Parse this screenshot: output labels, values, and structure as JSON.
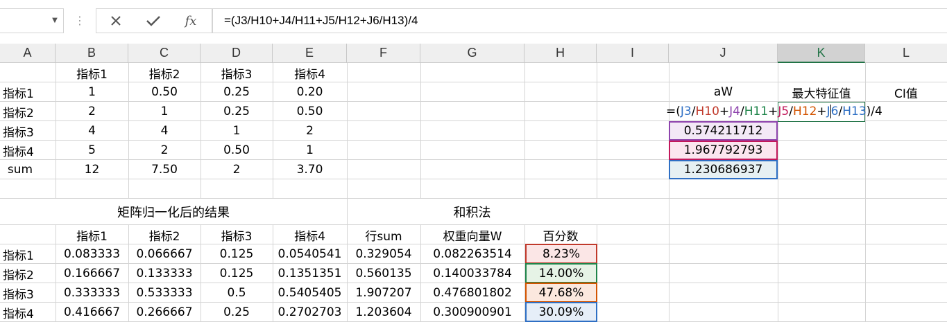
{
  "formula_bar": {
    "namebox_value": "",
    "cancel_icon": "close-icon",
    "enter_icon": "check-icon",
    "fx_label": "fx",
    "formula": "=(J3/H10+J4/H11+J5/H12+J6/H13)/4"
  },
  "columns": [
    "A",
    "B",
    "C",
    "D",
    "E",
    "F",
    "G",
    "H",
    "I",
    "J",
    "K",
    "L"
  ],
  "selected_column": "K",
  "top_table": {
    "headers": [
      "指标1",
      "指标2",
      "指标3",
      "指标4"
    ],
    "rows": [
      {
        "label": "指标1",
        "values": [
          "1",
          "0.50",
          "0.25",
          "0.20"
        ]
      },
      {
        "label": "指标2",
        "values": [
          "2",
          "1",
          "0.25",
          "0.50"
        ]
      },
      {
        "label": "指标3",
        "values": [
          "4",
          "4",
          "1",
          "2"
        ]
      },
      {
        "label": "指标4",
        "values": [
          "5",
          "2",
          "0.50",
          "1"
        ]
      },
      {
        "label": "sum",
        "values": [
          "12",
          "7.50",
          "2",
          "3.70"
        ]
      }
    ]
  },
  "right_block": {
    "header_aw": "aW",
    "header_lambda": "最大特征值",
    "header_ci": "CI值",
    "editing_formula_parts": [
      "=(",
      "J3",
      "/",
      "H10",
      "+",
      "J4",
      "/",
      "H11",
      "+",
      "J5",
      "/",
      "H12",
      "+",
      "J",
      "6",
      "/",
      "H13",
      ")/4"
    ],
    "values": [
      "0.574211712",
      "1.967792793",
      "1.230686937"
    ]
  },
  "bottom_section": {
    "title_normalized": "矩阵归一化后的结果",
    "title_method": "和积法",
    "headers": [
      "指标1",
      "指标2",
      "指标3",
      "指标4",
      "行sum",
      "权重向量W",
      "百分数"
    ],
    "rows": [
      {
        "label": "指标1",
        "values": [
          "0.083333",
          "0.066667",
          "0.125",
          "0.0540541",
          "0.329054",
          "0.082263514",
          "8.23%"
        ]
      },
      {
        "label": "指标2",
        "values": [
          "0.166667",
          "0.133333",
          "0.125",
          "0.1351351",
          "0.560135",
          "0.140033784",
          "14.00%"
        ]
      },
      {
        "label": "指标3",
        "values": [
          "0.333333",
          "0.533333",
          "0.5",
          "0.5405405",
          "1.907207",
          "0.476801802",
          "47.68%"
        ]
      },
      {
        "label": "指标4",
        "values": [
          "0.416667",
          "0.266667",
          "0.25",
          "0.2702703",
          "1.203604",
          "0.300900901",
          "30.09%"
        ]
      }
    ]
  },
  "colors": {
    "pct_fills": [
      "#fbe6e6",
      "#e6f3e6",
      "#fbe8de",
      "#e6eef8"
    ],
    "pct_borders": [
      "#c0392b",
      "#1e8449",
      "#d35400",
      "#2e6fc4"
    ],
    "j_fills": [
      "#f3e9f6",
      "#fbe6ef",
      "#e6f0f3"
    ],
    "j_borders": [
      "#8e44ad",
      "#c2185b",
      "#2e6fc4"
    ],
    "excel_green": "#217346"
  }
}
